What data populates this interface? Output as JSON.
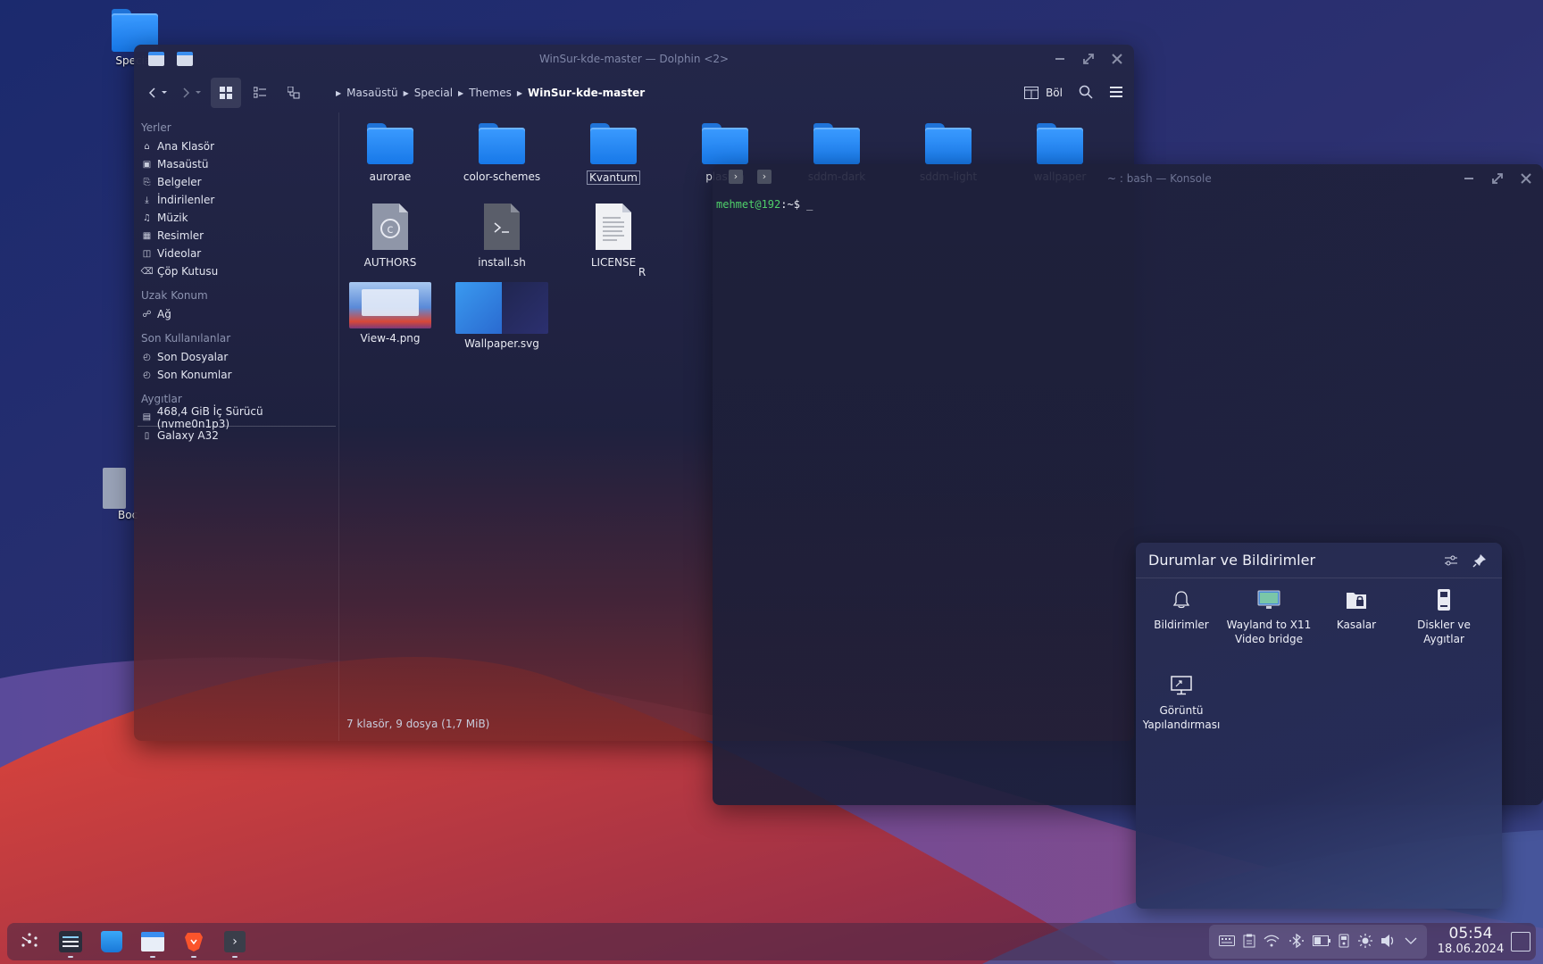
{
  "desktop": {
    "icons": [
      {
        "label": "Special"
      },
      {
        "label": "Boc"
      }
    ]
  },
  "dolphin": {
    "title": "WinSur-kde-master — Dolphin <2>",
    "split_label": "Böl",
    "breadcrumb": [
      "Masaüstü",
      "Special",
      "Themes",
      "WinSur-kde-master"
    ],
    "sidebar": {
      "places_header": "Yerler",
      "places": [
        {
          "label": "Ana Klasör",
          "icon": "home-icon"
        },
        {
          "label": "Masaüstü",
          "icon": "desktop-icon"
        },
        {
          "label": "Belgeler",
          "icon": "documents-icon"
        },
        {
          "label": "İndirilenler",
          "icon": "downloads-icon"
        },
        {
          "label": "Müzik",
          "icon": "music-icon"
        },
        {
          "label": "Resimler",
          "icon": "pictures-icon"
        },
        {
          "label": "Videolar",
          "icon": "videos-icon"
        },
        {
          "label": "Çöp Kutusu",
          "icon": "trash-icon"
        }
      ],
      "remote_header": "Uzak Konum",
      "remote": [
        {
          "label": "Ağ",
          "icon": "network-icon"
        }
      ],
      "recent_header": "Son Kullanılanlar",
      "recent": [
        {
          "label": "Son Dosyalar",
          "icon": "recent-files-icon"
        },
        {
          "label": "Son Konumlar",
          "icon": "recent-locations-icon"
        }
      ],
      "devices_header": "Aygıtlar",
      "devices": [
        {
          "label": "468,4 GiB İç Sürücü (nvme0n1p3)",
          "icon": "drive-icon"
        },
        {
          "label": "Galaxy A32",
          "icon": "phone-icon"
        }
      ]
    },
    "files": [
      {
        "name": "aurorae",
        "type": "folder"
      },
      {
        "name": "color-schemes",
        "type": "folder"
      },
      {
        "name": "Kvantum",
        "type": "folder"
      },
      {
        "name": "plasma",
        "type": "folder"
      },
      {
        "name": "sddm-dark",
        "type": "folder"
      },
      {
        "name": "sddm-light",
        "type": "folder"
      },
      {
        "name": "wallpaper",
        "type": "folder"
      },
      {
        "name": "AUTHORS",
        "type": "file"
      },
      {
        "name": "install.sh",
        "type": "script"
      },
      {
        "name": "LICENSE",
        "type": "text"
      },
      {
        "name": "R",
        "type": "partial"
      },
      {
        "name": "View-4.png",
        "type": "image"
      },
      {
        "name": "Wallpaper.svg",
        "type": "image"
      }
    ],
    "status": "7 klasör, 9 dosya (1,7 MiB)"
  },
  "konsole": {
    "title": "~ : bash — Konsole",
    "prompt_user": "mehmet@192",
    "prompt_rest": ":~$ _"
  },
  "notifications": {
    "title": "Durumlar ve Bildirimler",
    "applets": [
      {
        "label": "Bildirimler",
        "icon": "bell-icon"
      },
      {
        "label": "Wayland to X11 Video bridge",
        "icon": "video-bridge-icon"
      },
      {
        "label": "Kasalar",
        "icon": "vaults-icon"
      },
      {
        "label": "Diskler ve Aygıtlar",
        "icon": "disks-icon"
      },
      {
        "label": "Görüntü Yapılandırması",
        "icon": "display-config-icon"
      }
    ]
  },
  "taskbar": {
    "apps": [
      {
        "name": "app-launcher",
        "running": false
      },
      {
        "name": "system-settings",
        "running": true
      },
      {
        "name": "discover",
        "running": false
      },
      {
        "name": "dolphin",
        "running": true
      },
      {
        "name": "brave",
        "running": true
      },
      {
        "name": "konsole",
        "running": true
      }
    ],
    "tray": [
      "keyboard-icon",
      "clipboard-icon",
      "wifi-icon",
      "bluetooth-icon",
      "battery-icon",
      "usb-icon",
      "brightness-icon",
      "volume-icon",
      "expand-icon"
    ],
    "time": "05:54",
    "date": "18.06.2024"
  }
}
